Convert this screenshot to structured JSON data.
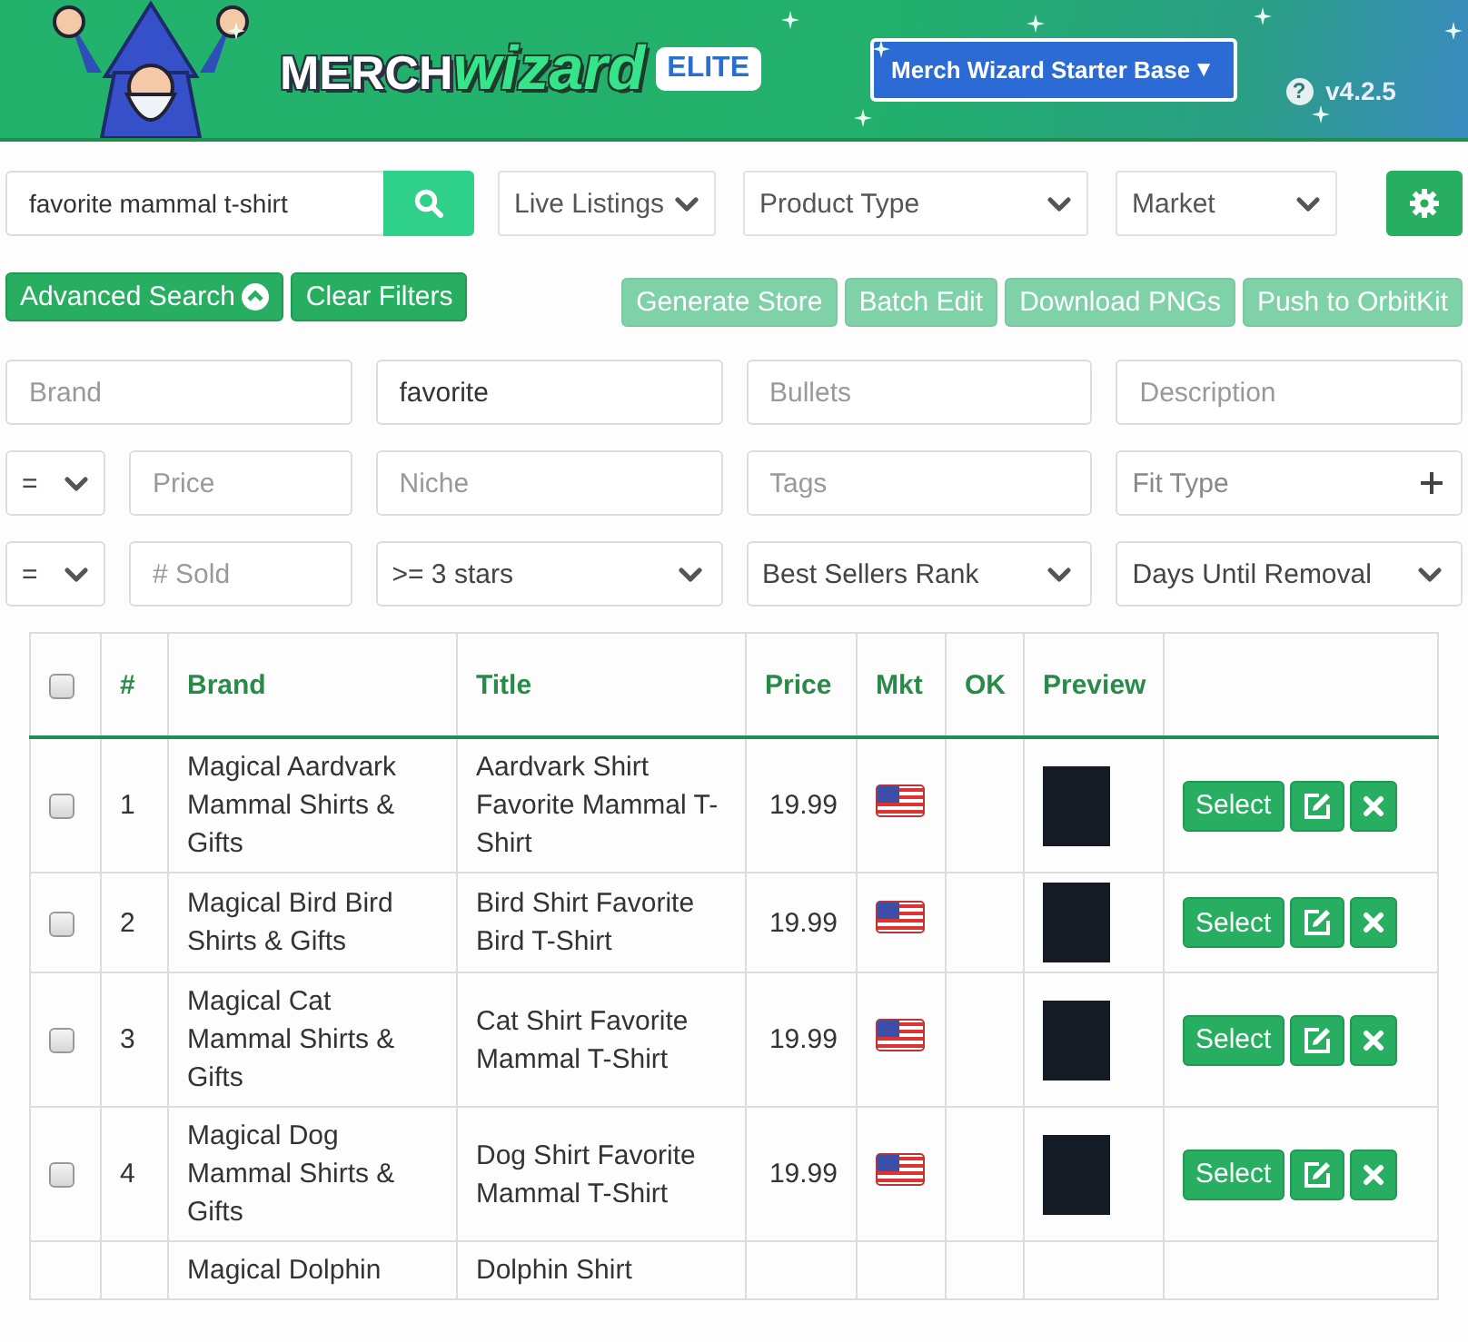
{
  "header": {
    "logo_word_1": "MERCH",
    "logo_word_2": "wizard",
    "badge": "ELITE",
    "base_selector": {
      "label": "Merch Wizard Starter Base",
      "caret": "▼"
    },
    "help": "?",
    "version": "v4.2.5"
  },
  "search": {
    "value": "favorite mammal t-shirt"
  },
  "selects": [
    {
      "label": "Live Listings"
    },
    {
      "label": "Product Type"
    },
    {
      "label": "Market"
    }
  ],
  "left_buttons": [
    {
      "label": "Advanced Search",
      "disabled": false,
      "kind": "toggle"
    },
    {
      "label": "Clear Filters",
      "disabled": false,
      "kind": "plain"
    }
  ],
  "right_buttons": [
    {
      "label": "Generate Store",
      "disabled": true
    },
    {
      "label": "Batch Edit",
      "disabled": true
    },
    {
      "label": "Download PNGs",
      "disabled": true
    },
    {
      "label": "Push to OrbitKit",
      "disabled": true
    }
  ],
  "filter_rows": [
    [
      {
        "kind": "field",
        "placeholder": "Brand"
      },
      {
        "kind": "field",
        "value": "favorite"
      },
      {
        "kind": "field",
        "placeholder": "Bullets"
      },
      {
        "kind": "field",
        "placeholder": "Description"
      }
    ],
    [
      {
        "kind": "operator",
        "value": "="
      },
      {
        "kind": "field",
        "placeholder": "Price"
      },
      {
        "kind": "field",
        "placeholder": "Niche"
      },
      {
        "kind": "field",
        "placeholder": "Tags"
      },
      {
        "kind": "multiselect",
        "placeholder": "Fit Type"
      }
    ],
    [
      {
        "kind": "operator",
        "value": "="
      },
      {
        "kind": "field",
        "placeholder": "# Sold"
      },
      {
        "kind": "select",
        "value": ">= 3 stars"
      },
      {
        "kind": "select",
        "value": "Best Sellers Rank"
      },
      {
        "kind": "select",
        "value": "Days Until Removal"
      }
    ]
  ],
  "table": {
    "select_all": {
      "checked": false
    },
    "columns": [
      "#",
      "Brand",
      "Title",
      "Price",
      "Mkt",
      "OK",
      "Preview"
    ],
    "rows": [
      {
        "checked": false,
        "number": "1",
        "brand": "Magical Aardvark Mammal Shirts & Gifts",
        "title": "Aardvark Shirt Favorite Mammal T-Shirt",
        "price": "19.99",
        "action": "Select"
      },
      {
        "checked": false,
        "number": "2",
        "brand": "Magical Bird Bird Shirts & Gifts",
        "title": "Bird Shirt Favorite Bird T-Shirt",
        "price": "19.99",
        "action": "Select"
      },
      {
        "checked": false,
        "number": "3",
        "brand": "Magical Cat Mammal Shirts & Gifts",
        "title": "Cat Shirt Favorite Mammal T-Shirt",
        "price": "19.99",
        "action": "Select"
      },
      {
        "checked": false,
        "number": "4",
        "brand": "Magical Dog Mammal Shirts & Gifts",
        "title": "Dog Shirt Favorite Mammal T-Shirt",
        "price": "19.99",
        "action": "Select"
      },
      {
        "brand": "Magical Dolphin",
        "title": "Dolphin Shirt"
      }
    ]
  }
}
